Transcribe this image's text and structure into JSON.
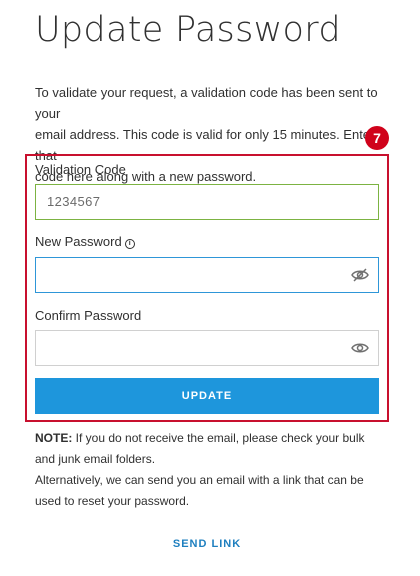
{
  "page": {
    "title": "Update Password",
    "intro_lines": [
      "To validate your request, a validation code has been sent to your",
      "email address. This code is valid for only 15 minutes. Enter that",
      "code here along with a new password."
    ],
    "step_badge": "7"
  },
  "form": {
    "validation_code": {
      "label": "Validation Code",
      "value": "1234567"
    },
    "new_password": {
      "label": "New Password",
      "info_icon": "ⓘ",
      "value": "",
      "eye_icon": "eye-slash-icon"
    },
    "confirm_password": {
      "label": "Confirm Password",
      "value": "",
      "eye_icon": "eye-icon"
    },
    "update_label": "UPDATE"
  },
  "note": {
    "prefix": "NOTE:",
    "line1": " If you do not receive the email, please check your bulk",
    "line2": "and junk email folders.",
    "line3": "Alternatively, we can send you an email with a link that can be",
    "line4": "used to reset your password."
  },
  "send_link_label": "SEND LINK",
  "colors": {
    "accent": "#1e96dc",
    "highlight_border": "#c8102e",
    "badge": "#d0021b",
    "valid_border": "#7cb342",
    "focus_border": "#2e96d8"
  }
}
